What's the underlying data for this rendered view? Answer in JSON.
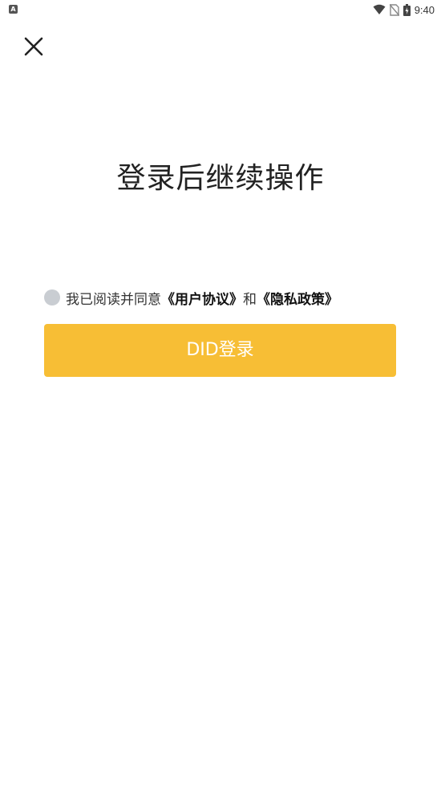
{
  "status_bar": {
    "app_icon_letter": "A",
    "time": "9:40",
    "icons": [
      "wifi-icon",
      "no-sim-icon",
      "battery-icon"
    ]
  },
  "header": {
    "close_icon": "close-icon"
  },
  "main": {
    "title": "登录后继续操作",
    "agreement": {
      "prefix": "我已阅读并同意",
      "user_agreement": "《用户协议》",
      "conjunction": "和",
      "privacy_policy": "《隐私政策》",
      "checked": false
    },
    "login_button_label": "DID登录"
  },
  "colors": {
    "accent": "#f7be35",
    "checkbox_unchecked": "#c9cdd2"
  }
}
